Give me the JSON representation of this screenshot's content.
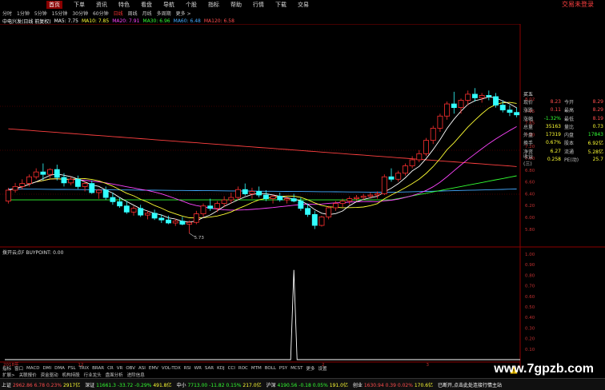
{
  "menu": {
    "items": [
      "首页",
      "下单",
      "资讯",
      "特色",
      "看盘",
      "导航",
      "个股",
      "指标",
      "帮助",
      "行情",
      "下载",
      "交易"
    ],
    "active_index": 0,
    "trade_link": "交易未登录"
  },
  "toolbar": {
    "periods": [
      "分时",
      "1分钟",
      "5分钟",
      "15分钟",
      "30分钟",
      "60分钟",
      "日线",
      "周线",
      "月线",
      "多周期",
      "更多 >"
    ],
    "selected_index": 6
  },
  "ma_legend": {
    "stock": "中电兴发(日线 前复权)",
    "ma5": "MA5: 7.75",
    "ma10": "MA10: 7.85",
    "ma20": "MA20: 7.91",
    "ma30": "MA30: 6.96",
    "ma60": "MA60: 6.48",
    "ma120": "MA120: 6.58"
  },
  "price_axis": [
    "8.02",
    "7.85",
    "7.65",
    "7.40",
    "7.20",
    "7.00",
    "6.80",
    "6.60",
    "6.40",
    "6.20",
    "6.00",
    "5.80"
  ],
  "low_marker": "5.73",
  "indicator": {
    "label": "拨开云点F  BUYPOINT: 0.00",
    "axis": [
      "1.00",
      "0.90",
      "0.80",
      "0.70",
      "0.60",
      "0.50",
      "0.40",
      "0.30",
      "0.20",
      "0.10"
    ]
  },
  "date_axis": {
    "year": "2018年",
    "labels": [
      "12",
      "2",
      "3"
    ]
  },
  "info_panel": {
    "header": "买五",
    "rows": [
      {
        "l1": "现价",
        "v1": "8.23",
        "l2": "今开",
        "v2": "8.29"
      },
      {
        "l1": "涨跌",
        "v1": "0.11",
        "l2": "最高",
        "v2": "8.29"
      },
      {
        "l1": "涨幅",
        "v1": "-1.32%",
        "l2": "最低",
        "v2": "8.19"
      },
      {
        "l1": "总量",
        "v1": "35163",
        "l2": "量比",
        "v2": "0.73"
      },
      {
        "l1": "外盘",
        "v1": "17319",
        "l2": "内盘",
        "v2": "17843"
      },
      {
        "l1": "换手",
        "v1": "0.67%",
        "l2": "股本",
        "v2": "6.92亿"
      },
      {
        "l1": "净资",
        "v1": "6.27",
        "l2": "流通",
        "v2": "5.28亿"
      },
      {
        "l1": "收益(三)",
        "v1": "0.258",
        "l2": "PE(动)",
        "v2": "25.7"
      }
    ]
  },
  "tabs1": [
    "指标",
    "窗口",
    "MACD",
    "DMI",
    "DMA",
    "FSL",
    "TRIX",
    "BRAR",
    "CR",
    "VR",
    "OBV",
    "ASI",
    "EMV",
    "VOL-TDX",
    "RSI",
    "WR",
    "SAR",
    "KDJ",
    "CCI",
    "ROC",
    "MTM",
    "BOLL",
    "PSY",
    "MCST",
    "更多",
    "设置"
  ],
  "tabs2": [
    "扩展>",
    "关联报价",
    "资金驱动",
    "机构持股",
    "行业龙头",
    "盘面分析",
    "进阶信息"
  ],
  "status": {
    "idx1_name": "上证",
    "idx1_val": "2962.86",
    "idx1_chg": "6.78",
    "idx1_pct": "0.23%",
    "idx1_amt": "2917亿",
    "idx2_name": "深证",
    "idx2_val": "11661.3",
    "idx2_chg": "-33.72",
    "idx2_pct": "-0.29%",
    "idx2_amt": "491.8亿",
    "idx3_name": "中小",
    "idx3_val": "7713.00",
    "idx3_chg": "-11.82",
    "idx3_pct": "0.15%",
    "idx3_amt": "217.0亿",
    "idx4_name": "沪深",
    "idx4_val": "4190.56",
    "idx4_chg": "-0.18",
    "idx4_pct": "0.05%",
    "idx4_amt": "191.0亿",
    "idx5_name": "创业",
    "idx5_val": "1630.94",
    "idx5_chg": "0.39",
    "idx5_pct": "0.02%",
    "idx5_amt": "170.6亿",
    "notice": "已断开,点击此处连接行情主站"
  },
  "watermark": "www.7gpzb.com",
  "colors": {
    "up": "#ff3030",
    "down": "#33ffff",
    "ma5": "#ffffff",
    "ma10": "#ffff33",
    "ma20": "#ff44ff",
    "ma30": "#33ff33",
    "ma60": "#44aaff",
    "ma120": "#ff4040",
    "grid": "#8b0000"
  },
  "chart_data": {
    "type": "candlestick",
    "price_range": [
      5.65,
      8.15
    ],
    "indicator_range": [
      0,
      1
    ],
    "candles": [
      [
        6.26,
        6.48,
        6.22,
        6.44
      ],
      [
        6.44,
        6.56,
        6.4,
        6.5
      ],
      [
        6.5,
        6.62,
        6.45,
        6.55
      ],
      [
        6.55,
        6.7,
        6.5,
        6.66
      ],
      [
        6.66,
        6.8,
        6.62,
        6.74
      ],
      [
        6.74,
        6.88,
        6.6,
        6.7
      ],
      [
        6.7,
        6.8,
        6.64,
        6.78
      ],
      [
        6.78,
        6.86,
        6.6,
        6.65
      ],
      [
        6.65,
        6.72,
        6.5,
        6.56
      ],
      [
        6.56,
        6.66,
        6.52,
        6.62
      ],
      [
        6.62,
        6.68,
        6.46,
        6.5
      ],
      [
        6.5,
        6.58,
        6.42,
        6.55
      ],
      [
        6.55,
        6.6,
        6.38,
        6.4
      ],
      [
        6.4,
        6.46,
        6.3,
        6.44
      ],
      [
        6.44,
        6.5,
        6.28,
        6.32
      ],
      [
        6.32,
        6.4,
        6.2,
        6.25
      ],
      [
        6.25,
        6.32,
        6.15,
        6.18
      ],
      [
        6.18,
        6.26,
        6.05,
        6.08
      ],
      [
        6.08,
        6.18,
        6.02,
        6.14
      ],
      [
        6.14,
        6.2,
        6.0,
        6.03
      ],
      [
        6.03,
        6.1,
        5.96,
        6.06
      ],
      [
        6.06,
        6.12,
        5.95,
        5.98
      ],
      [
        5.98,
        6.04,
        5.9,
        5.95
      ],
      [
        5.95,
        6.02,
        5.88,
        5.9
      ],
      [
        5.9,
        5.97,
        5.85,
        5.93
      ],
      [
        5.93,
        6.0,
        5.86,
        5.88
      ],
      [
        5.88,
        5.94,
        5.73,
        5.91
      ],
      [
        5.91,
        6.1,
        5.88,
        6.05
      ],
      [
        6.05,
        6.22,
        6.0,
        6.18
      ],
      [
        6.18,
        6.3,
        6.1,
        6.14
      ],
      [
        6.14,
        6.26,
        6.08,
        6.22
      ],
      [
        6.22,
        6.34,
        6.16,
        6.28
      ],
      [
        6.28,
        6.4,
        6.22,
        6.32
      ],
      [
        6.32,
        6.5,
        6.28,
        6.45
      ],
      [
        6.45,
        6.55,
        6.35,
        6.38
      ],
      [
        6.38,
        6.48,
        6.3,
        6.42
      ],
      [
        6.42,
        6.5,
        6.32,
        6.36
      ],
      [
        6.36,
        6.44,
        6.26,
        6.3
      ],
      [
        6.3,
        6.36,
        6.22,
        6.34
      ],
      [
        6.34,
        6.4,
        6.25,
        6.28
      ],
      [
        6.28,
        6.34,
        6.22,
        6.3
      ],
      [
        6.3,
        6.38,
        6.24,
        6.26
      ],
      [
        6.26,
        6.32,
        6.1,
        6.14
      ],
      [
        6.14,
        6.22,
        6.0,
        6.04
      ],
      [
        6.04,
        6.1,
        5.8,
        5.86
      ],
      [
        5.86,
        6.02,
        5.84,
        6.0
      ],
      [
        6.0,
        6.18,
        5.96,
        6.15
      ],
      [
        6.15,
        6.26,
        6.1,
        6.22
      ],
      [
        6.22,
        6.3,
        6.16,
        6.26
      ],
      [
        6.26,
        6.34,
        6.2,
        6.3
      ],
      [
        6.3,
        6.36,
        6.26,
        6.32
      ],
      [
        6.32,
        6.38,
        6.28,
        6.34
      ],
      [
        6.34,
        6.4,
        6.3,
        6.36
      ],
      [
        6.36,
        6.42,
        6.3,
        6.38
      ],
      [
        6.38,
        6.7,
        6.36,
        6.66
      ],
      [
        6.66,
        6.8,
        6.58,
        6.62
      ],
      [
        6.62,
        6.76,
        6.58,
        6.72
      ],
      [
        6.72,
        6.88,
        6.68,
        6.84
      ],
      [
        6.84,
        7.0,
        6.8,
        6.94
      ],
      [
        6.94,
        7.1,
        6.9,
        7.04
      ],
      [
        7.04,
        7.3,
        7.0,
        7.26
      ],
      [
        7.26,
        7.5,
        7.2,
        7.46
      ],
      [
        7.46,
        7.7,
        7.4,
        7.66
      ],
      [
        7.66,
        7.9,
        7.6,
        7.86
      ],
      [
        7.86,
        8.06,
        7.7,
        7.8
      ],
      [
        7.8,
        7.95,
        7.7,
        7.92
      ],
      [
        7.92,
        8.08,
        7.84,
        8.02
      ],
      [
        8.02,
        8.12,
        7.9,
        7.96
      ],
      [
        7.96,
        8.04,
        7.88,
        8.0
      ],
      [
        8.0,
        8.08,
        7.92,
        7.98
      ],
      [
        7.98,
        8.04,
        7.8,
        7.84
      ],
      [
        7.84,
        7.92,
        7.72,
        7.76
      ],
      [
        7.76,
        7.84,
        7.66,
        7.72
      ],
      [
        7.72,
        7.8,
        7.64,
        7.68
      ]
    ],
    "buypoint_spike_index": 41,
    "buypoint_spike_value": 0.85
  }
}
